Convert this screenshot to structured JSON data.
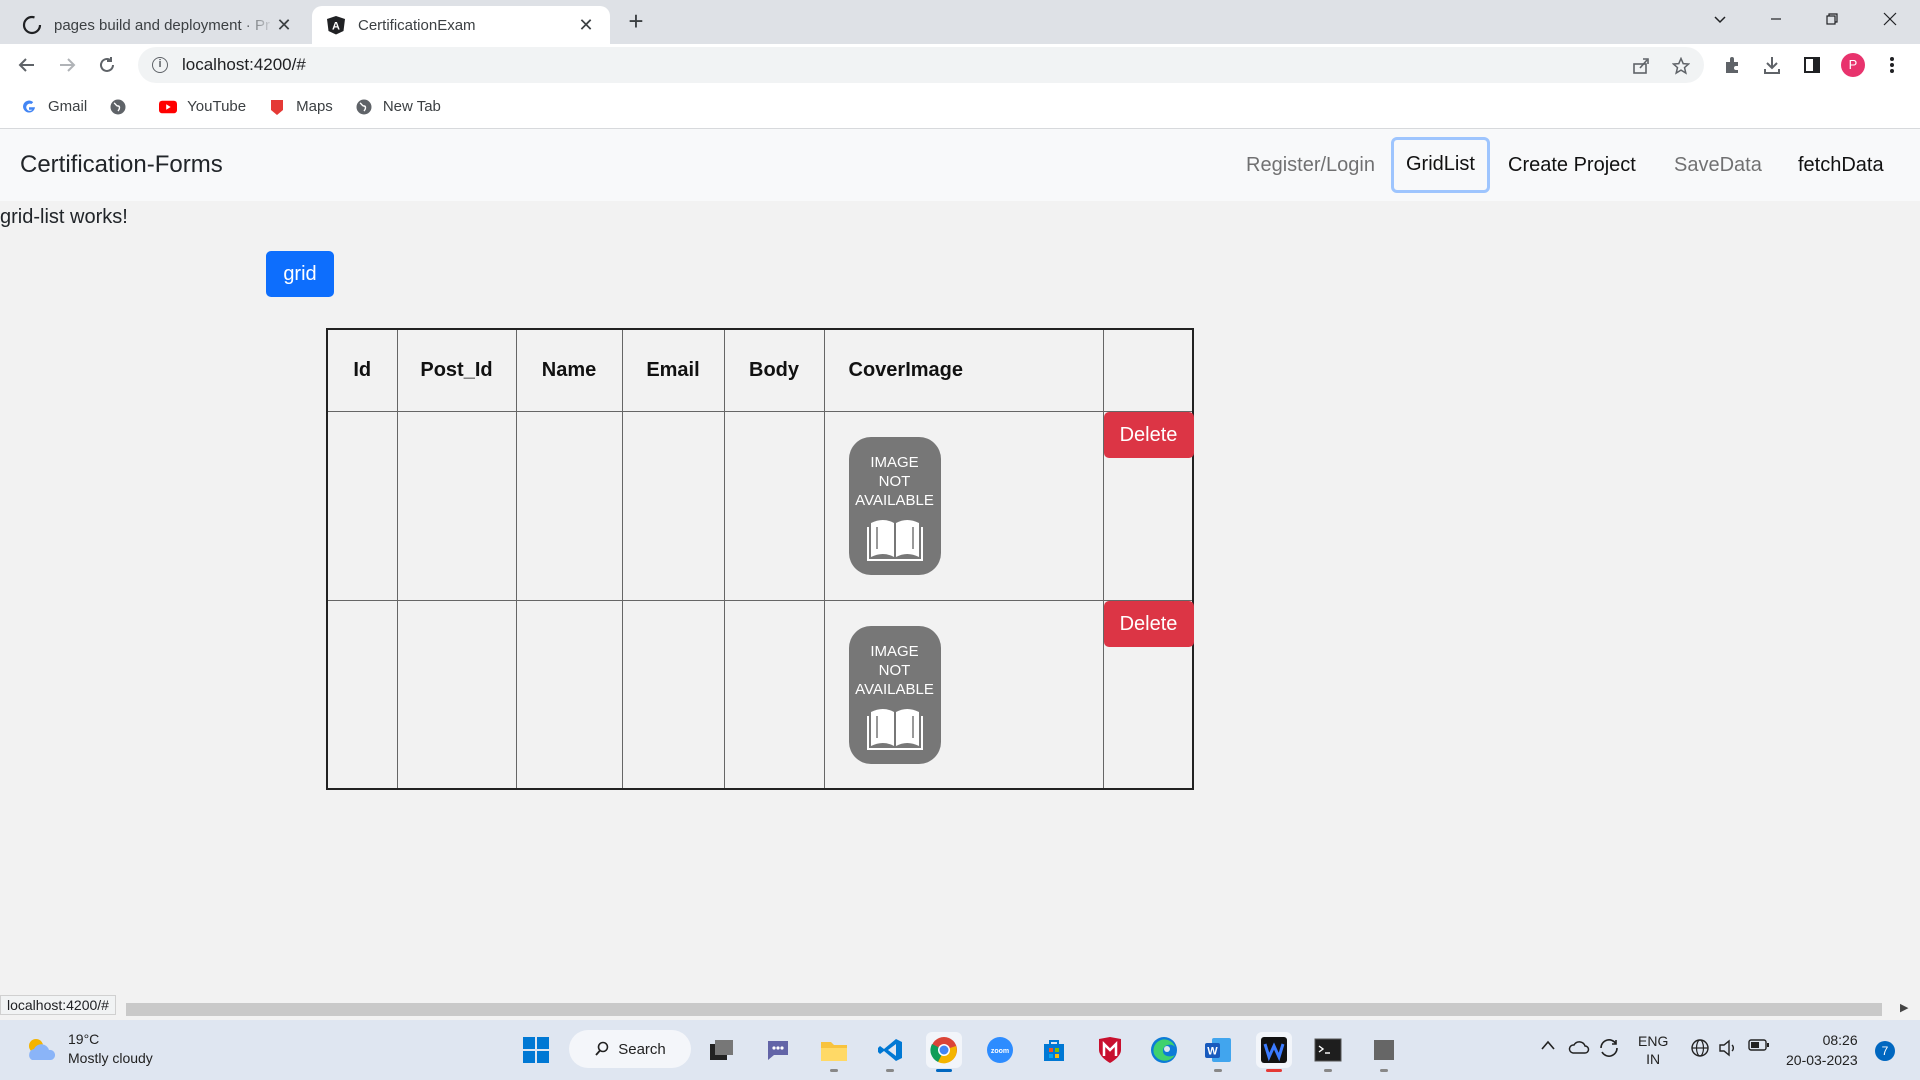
{
  "browser": {
    "tabs": [
      {
        "title": "pages build and deployment · Pr",
        "close": "✕"
      },
      {
        "title": "CertificationExam",
        "close": "✕"
      }
    ],
    "new_tab": "+",
    "url": "localhost:4200/#",
    "bookmarks": [
      {
        "label": "Gmail",
        "icon": "google-icon"
      },
      {
        "label": "",
        "icon": "globe-icon"
      },
      {
        "label": "YouTube",
        "icon": "youtube-icon"
      },
      {
        "label": "Maps",
        "icon": "maps-icon"
      },
      {
        "label": "New Tab",
        "icon": "globe-icon"
      }
    ],
    "profile_initial": "P",
    "status_url": "localhost:4200/#"
  },
  "app": {
    "brand": "Certification-Forms",
    "nav": [
      "Register/Login",
      "GridList",
      "Create Project",
      "SaveData",
      "fetchData"
    ],
    "message": "grid-list works!",
    "grid_button": "grid",
    "table": {
      "headers": [
        "Id",
        "Post_Id",
        "Name",
        "Email",
        "Body",
        "CoverImage",
        ""
      ],
      "rows": [
        {
          "id": "",
          "post_id": "",
          "name": "",
          "email": "",
          "body": "",
          "cover": "IMAGE NOT AVAILABLE",
          "action": "Delete"
        },
        {
          "id": "",
          "post_id": "",
          "name": "",
          "email": "",
          "body": "",
          "cover": "IMAGE NOT AVAILABLE",
          "action": "Delete"
        }
      ],
      "cover_lines": [
        "IMAGE",
        "NOT",
        "AVAILABLE"
      ]
    }
  },
  "taskbar": {
    "weather": {
      "temp": "19°C",
      "condition": "Mostly cloudy"
    },
    "search_label": "Search",
    "tray": {
      "lang1": "ENG",
      "lang2": "IN"
    },
    "time": "08:26",
    "date": "20-03-2023",
    "notifications": "7"
  }
}
